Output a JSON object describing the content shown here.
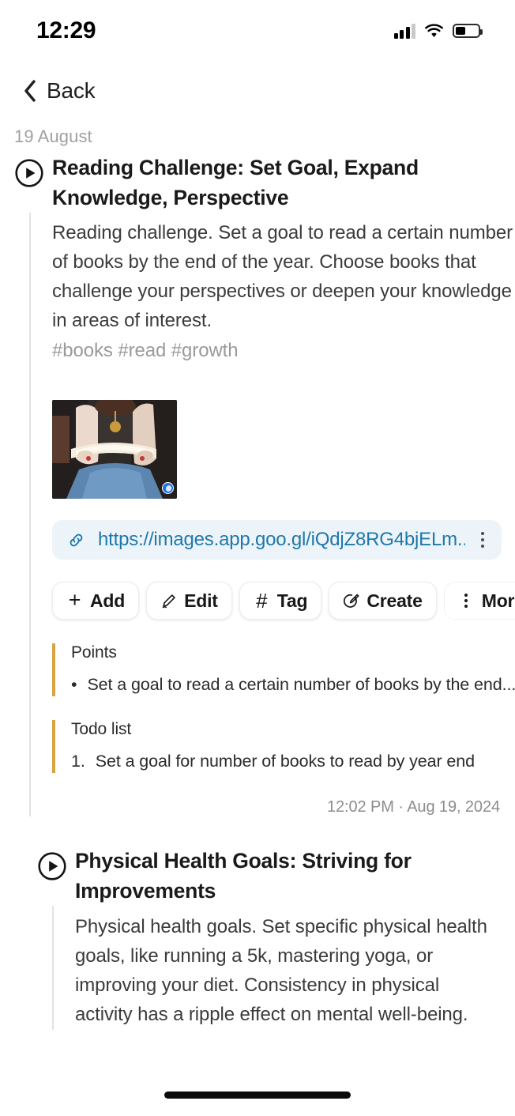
{
  "status_bar": {
    "time": "12:29",
    "signal_icon": "cellular-signal-icon",
    "wifi_icon": "wifi-icon",
    "battery_icon": "battery-icon"
  },
  "nav": {
    "back_label": "Back",
    "back_icon": "chevron-left-icon"
  },
  "feed": {
    "date_header": "19 August",
    "entries": [
      {
        "play_icon": "play-circle-icon",
        "title": "Reading Challenge: Set Goal, Expand Knowledge, Perspective",
        "body": "Reading challenge. Set a goal to read a certain number of books by the end of the year. Choose books that challenge your perspectives or deepen your knowledge in areas of interest.",
        "tags": "#books #read #growth",
        "attachment": {
          "thumbnail_alt": "person reading an open book",
          "badge_icon": "browser-badge-icon"
        },
        "link": {
          "icon": "link-chain-icon",
          "url": "https://images.app.goo.gl/iQdjZ8RG4bjELm...",
          "menu_icon": "more-vertical-icon"
        },
        "actions": [
          {
            "icon": "plus-icon",
            "label": "Add"
          },
          {
            "icon": "pencil-icon",
            "label": "Edit"
          },
          {
            "icon": "hash-icon",
            "label": "Tag"
          },
          {
            "icon": "create-circle-pen-icon",
            "label": "Create"
          },
          {
            "icon": "more-vertical-icon",
            "label": "More"
          }
        ],
        "blocks": [
          {
            "title": "Points",
            "marker": "•",
            "item": "Set a goal to read a certain number of books by the end..."
          },
          {
            "title": "Todo list",
            "marker": "1.",
            "item": "Set a goal for number of books to read by year end"
          }
        ],
        "timestamp": "12:02 PM · Aug 19, 2024"
      },
      {
        "play_icon": "play-circle-icon",
        "title": "Physical Health Goals: Striving for Improvements",
        "body": "Physical health goals. Set specific physical health goals, like running a 5k, mastering yoga, or improving your diet. Consistency in physical activity has a ripple effect on mental well-being."
      }
    ]
  },
  "colors": {
    "accent_link": "#1e78ab",
    "link_chip_bg": "#edf4f9",
    "quote_border": "#d9a441",
    "muted_text": "#9a9a9e",
    "thread_line": "#e2e2e4"
  },
  "home_indicator": "home-indicator"
}
